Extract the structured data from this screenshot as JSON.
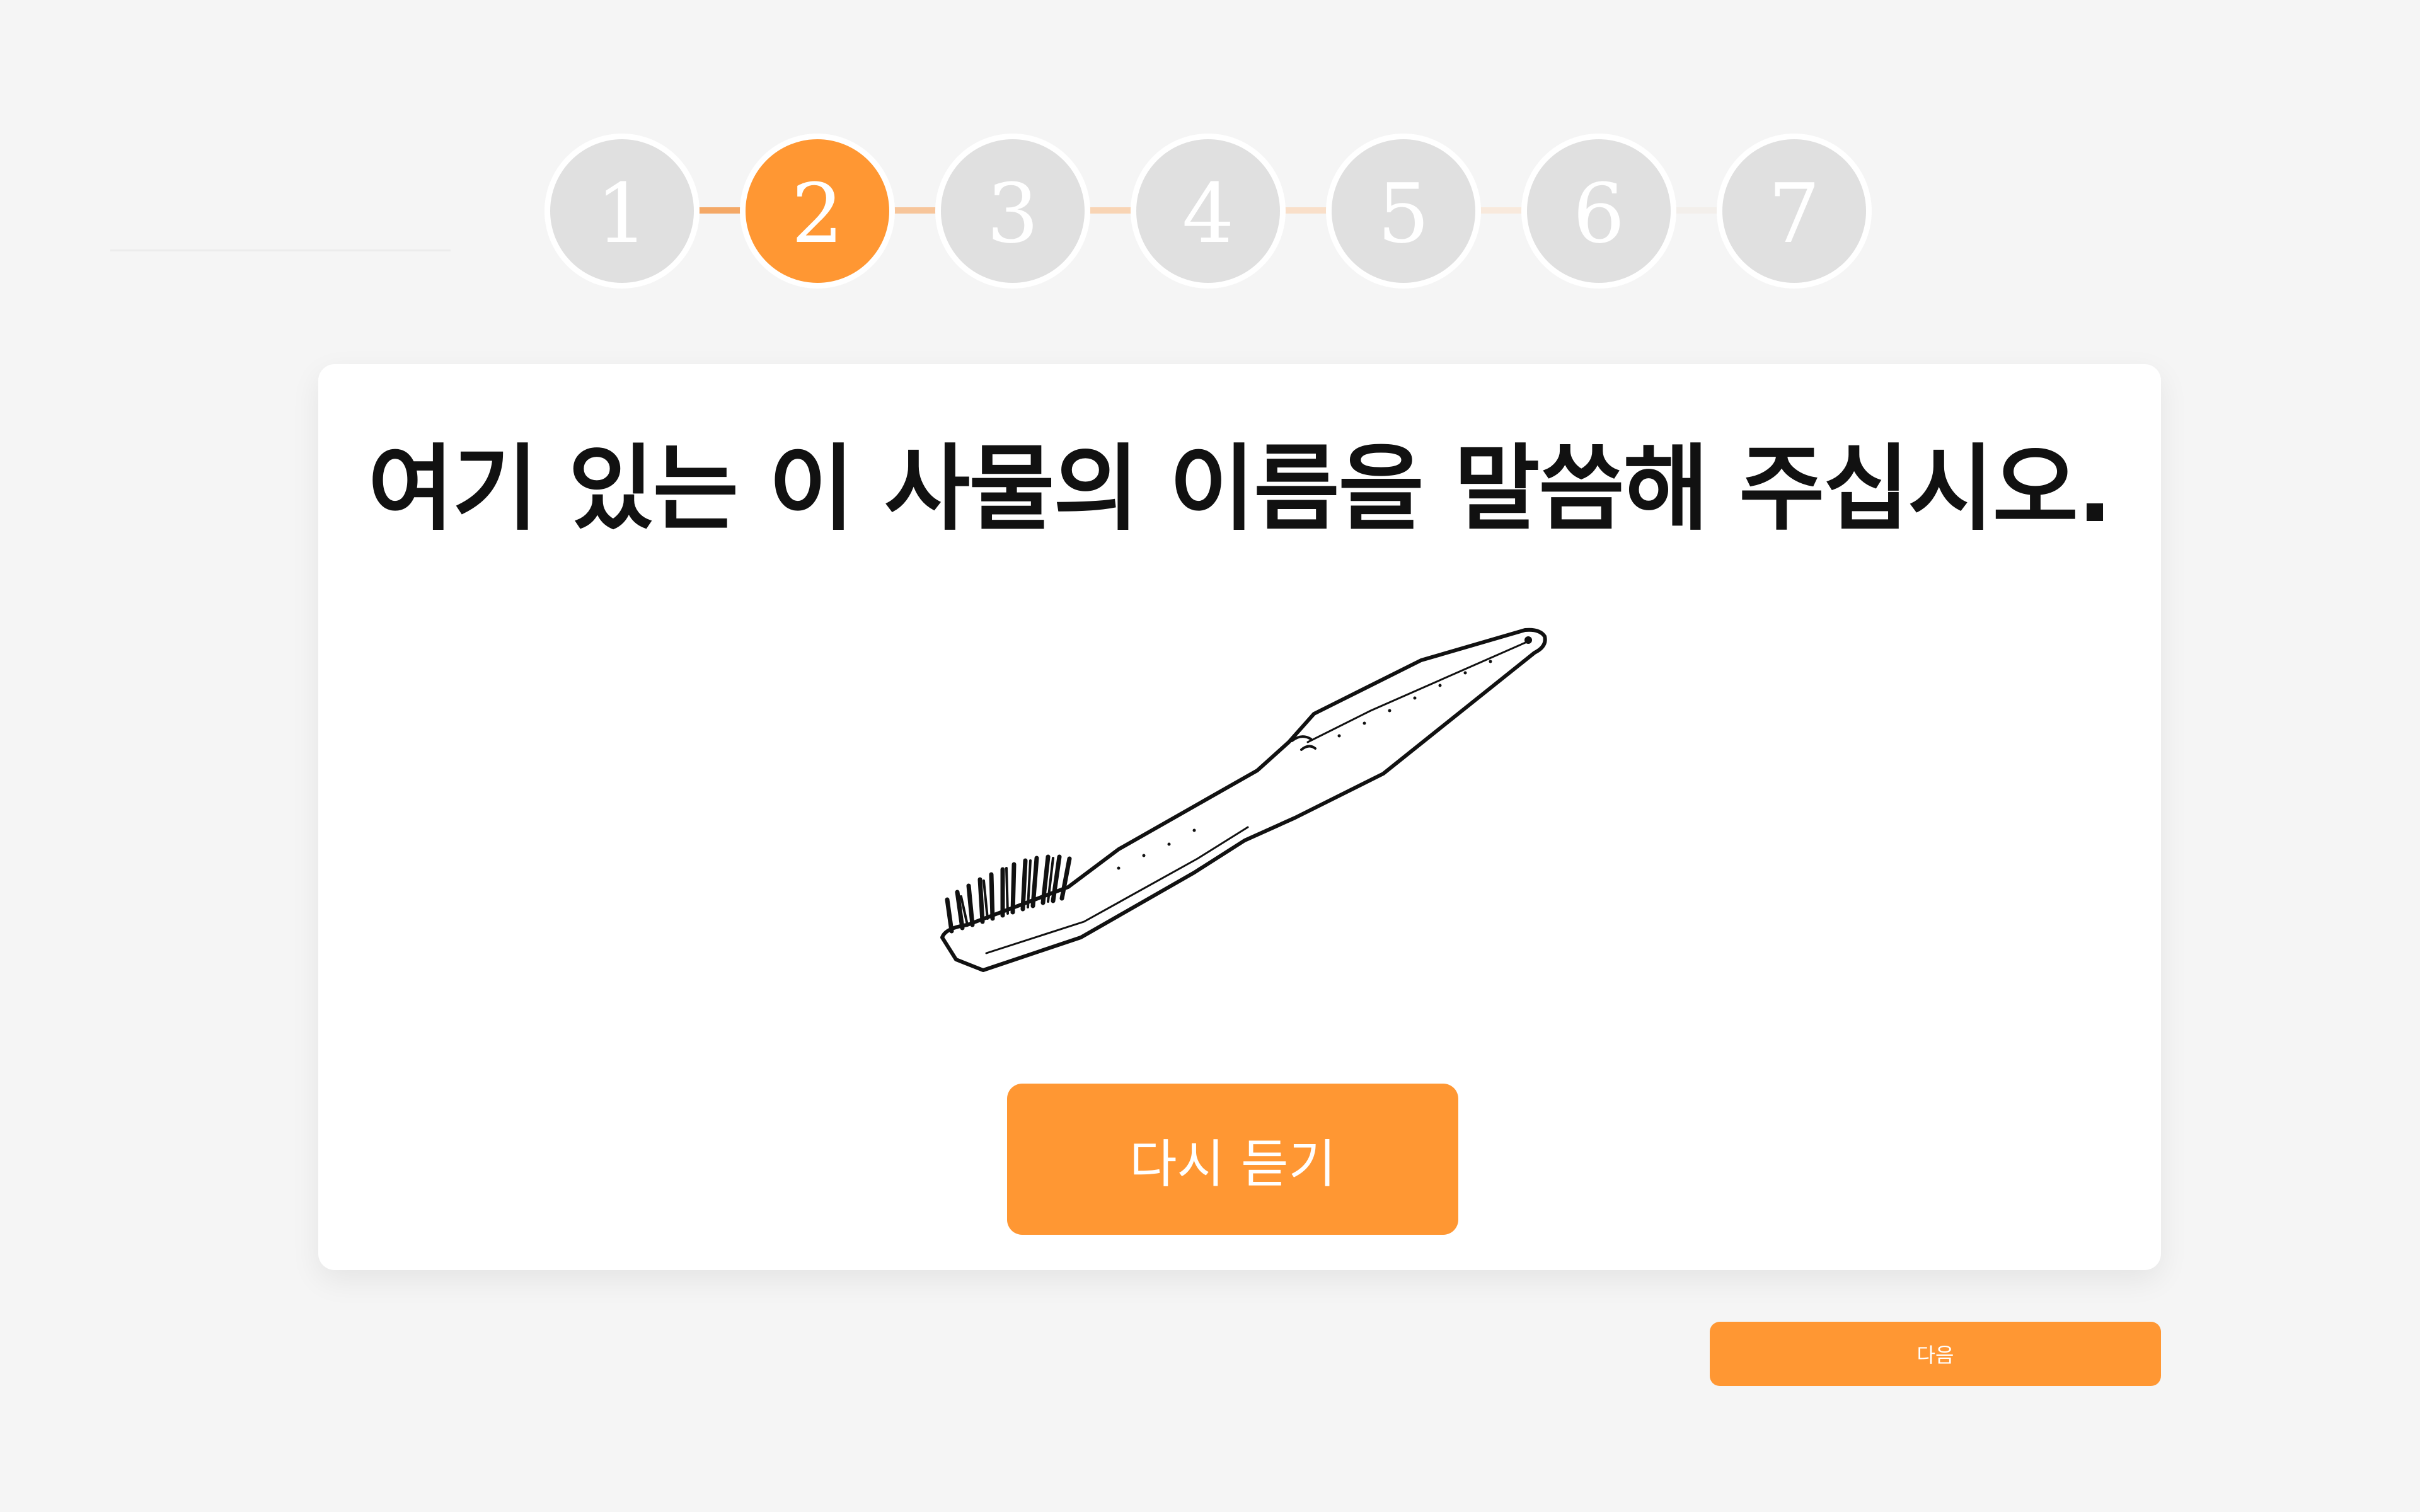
{
  "stepper": {
    "steps": [
      "1",
      "2",
      "3",
      "4",
      "5",
      "6",
      "7"
    ],
    "active_index": 1,
    "accent_color": "#ff9733",
    "inactive_color": "#e0e0e0"
  },
  "card": {
    "prompt": "여기 있는 이 사물의 이름을 말씀해 주십시오.",
    "image_icon": "toothbrush-illustration",
    "replay_label": "다시 듣기"
  },
  "footer": {
    "next_label": "다음"
  }
}
